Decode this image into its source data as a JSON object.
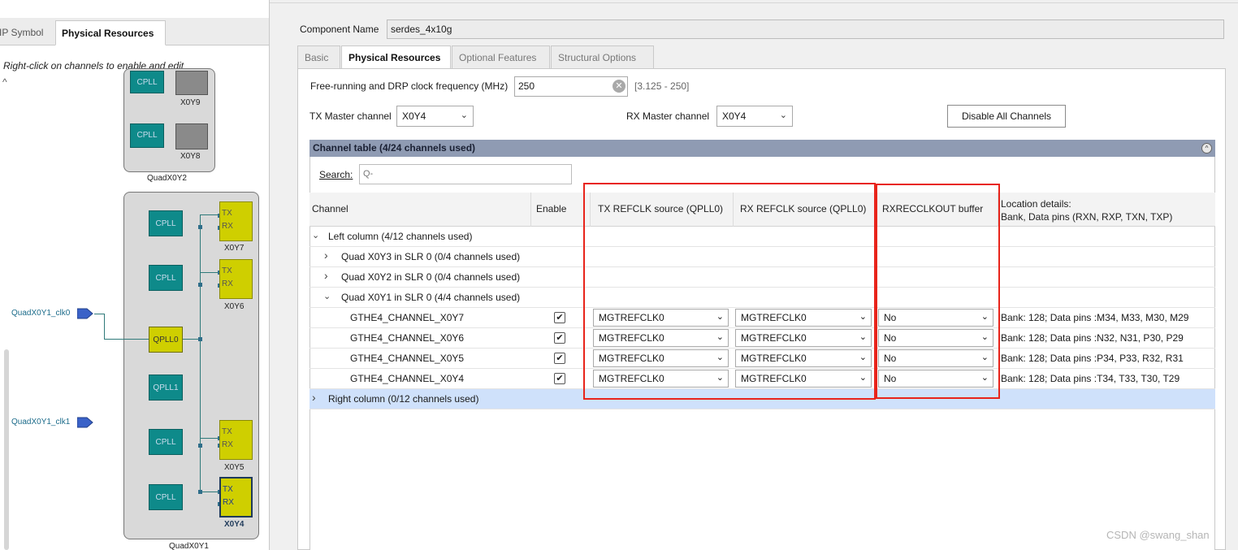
{
  "left": {
    "tabs": [
      {
        "label": "IP Symbol"
      },
      {
        "label": "Physical Resources"
      }
    ],
    "hint": "Right-click on channels to enable and edit",
    "scroll_up": "^",
    "quad2": {
      "cpll_label": "CPLL",
      "ch_top_label": "X0Y9",
      "ch_bottom_label": "X0Y8",
      "quad_label": "QuadX0Y2"
    },
    "quad1": {
      "quad_label": "QuadX0Y1",
      "cpll_label": "CPLL",
      "qpll0_label": "QPLL0",
      "qpll1_label": "QPLL1",
      "tx": "TX",
      "rx": "RX",
      "channels": [
        "X0Y7",
        "X0Y6",
        "X0Y5",
        "X0Y4"
      ],
      "clk0": "QuadX0Y1_clk0",
      "clk1": "QuadX0Y1_clk1"
    }
  },
  "form": {
    "component_name_label": "Component Name",
    "component_name": "serdes_4x10g",
    "tabs": [
      {
        "label": "Basic"
      },
      {
        "label": "Physical Resources"
      },
      {
        "label": "Optional Features"
      },
      {
        "label": "Structural Options"
      }
    ],
    "freq_label": "Free-running and DRP clock frequency (MHz)",
    "freq_value": "250",
    "freq_range": "[3.125 - 250]",
    "tx_master_label": "TX Master channel",
    "tx_master_value": "X0Y4",
    "rx_master_label": "RX Master channel",
    "rx_master_value": "X0Y4",
    "disable_all_label": "Disable All Channels"
  },
  "table": {
    "title": "Channel table (4/24 channels used)",
    "search_label": "Search:",
    "search_placeholder": "Q-",
    "columns": {
      "channel": "Channel",
      "enable": "Enable",
      "tx_refclk": "TX REFCLK source (QPLL0)",
      "rx_refclk": "RX REFCLK source (QPLL0)",
      "rxrecclk": "RXRECCLKOUT buffer",
      "location_line1": "Location details:",
      "location_line2": "Bank, Data pins (RXN, RXP, TXN, TXP)"
    },
    "groups": {
      "left_column": "Left column (4/12 channels used)",
      "quad3": "Quad X0Y3 in SLR 0 (0/4 channels used)",
      "quad2": "Quad X0Y2 in SLR 0 (0/4 channels used)",
      "quad1": "Quad X0Y1 in SLR 0 (4/4 channels used)",
      "right_column": "Right column (0/12 channels used)"
    },
    "rows": [
      {
        "name": "GTHE4_CHANNEL_X0Y7",
        "tx": "MGTREFCLK0",
        "rx": "MGTREFCLK0",
        "buf": "No",
        "loc": "Bank: 128; Data pins :M34, M33, M30, M29"
      },
      {
        "name": "GTHE4_CHANNEL_X0Y6",
        "tx": "MGTREFCLK0",
        "rx": "MGTREFCLK0",
        "buf": "No",
        "loc": "Bank: 128; Data pins :N32, N31, P30, P29"
      },
      {
        "name": "GTHE4_CHANNEL_X0Y5",
        "tx": "MGTREFCLK0",
        "rx": "MGTREFCLK0",
        "buf": "No",
        "loc": "Bank: 128; Data pins :P34, P33, R32, R31"
      },
      {
        "name": "GTHE4_CHANNEL_X0Y4",
        "tx": "MGTREFCLK0",
        "rx": "MGTREFCLK0",
        "buf": "No",
        "loc": "Bank: 128; Data pins :T34, T33, T30, T29"
      }
    ]
  },
  "icons": {
    "chevron_down": "⌄",
    "chevron_right": "›",
    "check": "✔",
    "clear": "✕",
    "collapse": "^"
  },
  "watermark": "CSDN @swang_shan",
  "colors": {
    "accent_red": "#e8241b",
    "table_header": "#8f9bb3",
    "selected_row": "#cfe1fb",
    "cpll": "#0e8a8a",
    "channel": "#cfcf00"
  }
}
